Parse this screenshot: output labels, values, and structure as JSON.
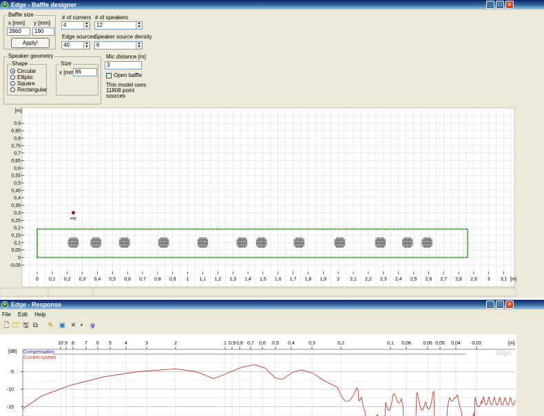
{
  "baffle_window": {
    "title": "Edge - Baffle designer",
    "baffle_size": {
      "group_label": "Baffle size",
      "x_label": "x [mm]",
      "y_label": "y [mm]",
      "x_value": "2860",
      "y_value": "190",
      "apply_label": "Apply!"
    },
    "corners": {
      "label": "# of corners",
      "value": "4"
    },
    "speakers": {
      "label": "# of speakers",
      "value": "12"
    },
    "edge_sources": {
      "label": "Edge sources",
      "value": "40"
    },
    "source_density": {
      "label": "Speaker source density",
      "value": "6"
    },
    "geometry": {
      "group_label": "Speaker geometry",
      "shape_label": "Shape",
      "shapes": [
        "Circular",
        "Elliptic",
        "Square",
        "Rectangular"
      ],
      "selected_shape": "Circular",
      "size_label": "Size",
      "size_x_label": "x [mm]",
      "size_x_value": "86"
    },
    "mic_distance": {
      "label": "Mic distance [m]",
      "value": "3"
    },
    "open_baffle": {
      "label": "Open baffle",
      "checked": true
    },
    "model_info": [
      "This model uses",
      "11808 point",
      "sources"
    ],
    "plot": {
      "y_unit": "[m]",
      "x_unit": "[m]",
      "mic_label": "mic",
      "y_ticks": [
        "0,9",
        "0,85",
        "0,8",
        "0,75",
        "0,7",
        "0,65",
        "0,6",
        "0,55",
        "0,5",
        "0,45",
        "0,4",
        "0,35",
        "0,3",
        "0,25",
        "0,2",
        "0,15",
        "0,1",
        "0,05",
        "0",
        "-0,05"
      ],
      "x_ticks": [
        "0",
        "0,1",
        "0,2",
        "0,3",
        "0,4",
        "0,5",
        "0,6",
        "0,7",
        "0,8",
        "0,9",
        "1",
        "1,1",
        "1,2",
        "1,3",
        "1,4",
        "1,5",
        "1,6",
        "1,7",
        "1,8",
        "1,9",
        "2",
        "2,1",
        "2,2",
        "2,3",
        "2,4",
        "2,5",
        "2,6",
        "2,7",
        "2,8",
        "2,9",
        "3",
        "3,1"
      ]
    },
    "colors": {
      "baffle_outline": "#1e8c1e",
      "speaker": "#555555",
      "mic": "#8b1a1a",
      "grid": "#d8d8d8"
    }
  },
  "response_window": {
    "title": "Edge - Response",
    "menu": [
      "File",
      "Edit",
      "Help"
    ],
    "toolbar_icons": [
      "new-icon",
      "open-icon",
      "save-icon",
      "copy-icon",
      "edit-icon",
      "image-icon",
      "cross-icon",
      "dropdown-icon",
      "phi-icon"
    ],
    "plot": {
      "top_ticks": [
        "10",
        "9",
        "8",
        "7",
        "6",
        "5",
        "4",
        "3",
        "2",
        "1",
        "0,9",
        "0,8",
        "0,7",
        "0,6",
        "0,5",
        "0,4",
        "0,3",
        "0,2",
        "0,1",
        "0,08",
        "0,06",
        "0,05",
        "0,04",
        "0,03"
      ],
      "top_unit": "[m]",
      "y_unit": "[dB]",
      "y_ticks": [
        "-5",
        "-10",
        "-15"
      ],
      "legend": [
        {
          "name": "Compensation",
          "color": "#1a1aa0"
        },
        {
          "name": "Current system",
          "color": "#c0392b"
        }
      ],
      "watermark": "Edge"
    }
  }
}
